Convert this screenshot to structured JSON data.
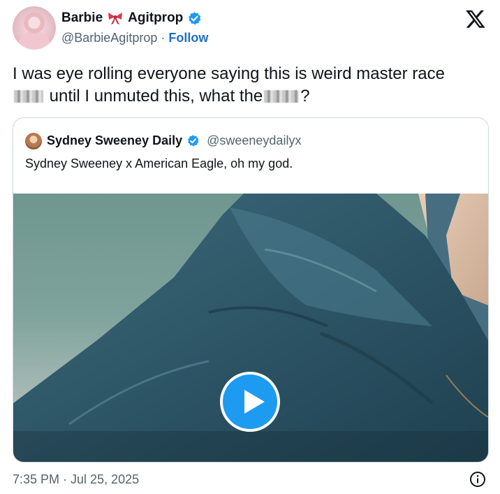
{
  "author": {
    "display_name_first": "Barbie",
    "display_name_second": "Agitprop",
    "handle": "@BarbieAgitprop",
    "separator": " · ",
    "follow_label": "Follow"
  },
  "tweet": {
    "line1": "I was eye rolling everyone saying this is weird master race",
    "line2_part1": " until I unmuted this, what the",
    "line2_part2": "?"
  },
  "quoted": {
    "display_name": "Sydney Sweeney Daily",
    "handle": "@sweeneydailyx",
    "text": "Sydney Sweeney x American Eagle, oh my god."
  },
  "meta": {
    "timestamp": "7:35 PM · Jul 25, 2025"
  },
  "icons": {
    "bow": "bow-icon",
    "verified": "verified-badge-icon",
    "brand": "x-logo-icon",
    "play": "play-icon",
    "info": "info-icon"
  },
  "colors": {
    "accent": "#1d9bf0",
    "follow": "#1d6fc9",
    "secondary_text": "#536471",
    "border": "#cfd9de",
    "bow": "#d93a4a"
  }
}
